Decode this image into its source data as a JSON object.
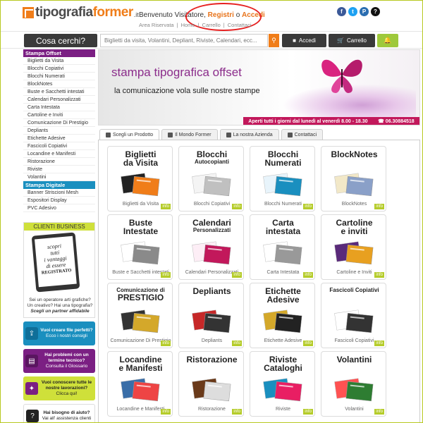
{
  "header": {
    "logo_part1": "tipografia",
    "logo_part2": "former",
    "logo_tld": ".it",
    "welcome_text": "Benvenuto Visitatore,",
    "register_link": "Registri",
    "or_text": "o",
    "login_link": "Accedi",
    "top_links": [
      "Area Riservata",
      "|",
      "Home",
      "|",
      "Carrello",
      "|",
      "Contattaci"
    ],
    "social": [
      {
        "icon": "facebook-icon",
        "glyph": "f",
        "color": "#3b5998"
      },
      {
        "icon": "twitter-icon",
        "glyph": "t",
        "color": "#1da1f2"
      },
      {
        "icon": "pinterest-icon",
        "glyph": "P",
        "color": "#2a6db0"
      },
      {
        "icon": "help-icon",
        "glyph": "?",
        "color": "#111111"
      }
    ]
  },
  "searchbar": {
    "label": "Cosa cerchi?",
    "placeholder": "Biglietti da visita, Volantini, Depliant, Riviste, Calendari, ecc...",
    "search_icon": "magnifier-icon",
    "login_label": "Accedi",
    "cart_label": "Carrello",
    "bell_icon": "bell-icon"
  },
  "sidebar": {
    "cat_offset": "Stampa Offset",
    "offset_items": [
      "Biglietti da Visita",
      "Blocchi Copiativi",
      "Blocchi Numerati",
      "BlockNotes",
      "Buste e Sacchetti intestati",
      "Calendari Personalizzati",
      "Carta Intestata",
      "Cartoline e Inviti",
      "Comunicazione Di Prestigio",
      "Depliants",
      "Etichette Adesive",
      "Fascicoli Copiativi",
      "Locandine e Manifesti",
      "Ristorazione",
      "Riviste",
      "Volantini"
    ],
    "cat_digital": "Stampa Digitale",
    "digital_items": [
      "Banner Striscioni Mesh",
      "Espositori Display",
      "PVC Adesivo"
    ],
    "clienti": {
      "header": "CLIENTI BUSINESS",
      "tablet_lines": [
        "scopri",
        "tutti",
        "i vantaggi",
        "di essere",
        "REGISTRATO"
      ],
      "text1": "Sei un operatore arti grafiche?",
      "text2": "Un creativo? Hai una tipografia?",
      "text3": "Scegli un partner affidabile"
    },
    "boxes": [
      {
        "title": "Vuoi creare file perfetti?",
        "sub": "Ecco i nostri consigli",
        "bg": "#1a8fbf",
        "icon_bg": "#0f6f99",
        "icon": "upload-icon",
        "glyph": "⇪",
        "dark": false
      },
      {
        "title": "Hai problemi con un termine tecnico?",
        "sub": "Consulta il Glossario",
        "bg": "#7b1f83",
        "icon_bg": "#5a1560",
        "icon": "book-icon",
        "glyph": "▤",
        "dark": false
      },
      {
        "title": "Vuoi conoscere tutte le nostre lavorazioni?",
        "sub": "Clicca qui!",
        "bg": "#cfe03a",
        "icon_bg": "#7b1f83",
        "icon": "magic-wand-icon",
        "glyph": "✦",
        "dark": true
      },
      {
        "title": "Hai bisogno di aiuto?",
        "sub": "Vai all' assistenza clienti",
        "bg": "#ffffff",
        "icon_bg": "#222222",
        "icon": "help-circle-icon",
        "glyph": "?",
        "dark": true
      }
    ]
  },
  "banner": {
    "title": "stampa tipografica offset",
    "subtitle": "la comunicazione vola sulle nostre stampe",
    "hours": "Aperti tutti i giorni dal lunedì al venerdì 8.00 - 18.30",
    "phone": "06.30884518",
    "clock_icon": "clock-icon"
  },
  "tabs": [
    {
      "label": "Scegli un Prodotto",
      "active": true
    },
    {
      "label": "Il Mondo Former",
      "active": false
    },
    {
      "label": "La nostra Azienda",
      "active": false
    },
    {
      "label": "Contattaci",
      "active": false
    }
  ],
  "products": [
    {
      "t1": "Biglietti",
      "t2": "da Visita",
      "sub": "",
      "caption": "Biglietti da Visita",
      "info": "info",
      "img": "business-cards-image"
    },
    {
      "t1": "Blocchi",
      "t2": "",
      "sub": "Autocopianti",
      "caption": "Blocchi Copiativi",
      "info": "info",
      "img": "carbon-pads-image"
    },
    {
      "t1": "Blocchi",
      "t2": "Numerati",
      "sub": "",
      "caption": "Blocchi Numerati",
      "info": "info",
      "img": "numbered-pads-image"
    },
    {
      "t1": "BlockNotes",
      "t2": "",
      "sub": "",
      "caption": "BlockNotes",
      "info": "info",
      "img": "notepads-image"
    },
    {
      "t1": "Buste",
      "t2": "Intestate",
      "sub": "",
      "caption": "Buste e Sacchetti intestati",
      "info": "info",
      "img": "envelopes-image"
    },
    {
      "t1": "Calendari",
      "t2": "",
      "sub": "Personalizzati",
      "caption": "Calendari Personalizzati",
      "info": "info",
      "img": "calendars-image"
    },
    {
      "t1": "Carta",
      "t2": "intestata",
      "sub": "",
      "caption": "Carta Intestata",
      "info": "info",
      "img": "letterhead-image"
    },
    {
      "t1": "Cartoline",
      "t2": "e inviti",
      "sub": "",
      "caption": "Cartoline e Inviti",
      "info": "info",
      "img": "postcards-image"
    },
    {
      "t1": "",
      "t2": "PRESTIGIO",
      "sub": "Comunicazione di",
      "caption": "Comunicazione Di Prestigio",
      "info": "info",
      "img": "prestige-image"
    },
    {
      "t1": "Depliants",
      "t2": "",
      "sub": "",
      "caption": "Depliants",
      "info": "info",
      "img": "brochures-image"
    },
    {
      "t1": "Etichette",
      "t2": "Adesive",
      "sub": "",
      "caption": "Etichette Adesive",
      "info": "info",
      "img": "labels-image"
    },
    {
      "t1": "",
      "t2": "",
      "sub": "Fascicoli Copiativi",
      "caption": "Fascicoli Copiativi",
      "info": "info",
      "img": "copy-booklets-image"
    },
    {
      "t1": "Locandine",
      "t2": "e Manifesti",
      "sub": "",
      "caption": "Locandine e Manifesti",
      "info": "info",
      "img": "posters-image"
    },
    {
      "t1": "Ristorazione",
      "t2": "",
      "sub": "",
      "caption": "Ristorazione",
      "info": "info",
      "img": "restaurant-image"
    },
    {
      "t1": "Riviste",
      "t2": "Cataloghi",
      "sub": "",
      "caption": "Riviste",
      "info": "info",
      "img": "magazines-image"
    },
    {
      "t1": "Volantini",
      "t2": "",
      "sub": "",
      "caption": "Volantini",
      "info": "info",
      "img": "flyers-image"
    }
  ],
  "colors": {
    "orange": "#f07d19",
    "purple": "#7b1f83",
    "green": "#cfe03a",
    "blue": "#1a8fbf",
    "magenta": "#c2185b"
  }
}
